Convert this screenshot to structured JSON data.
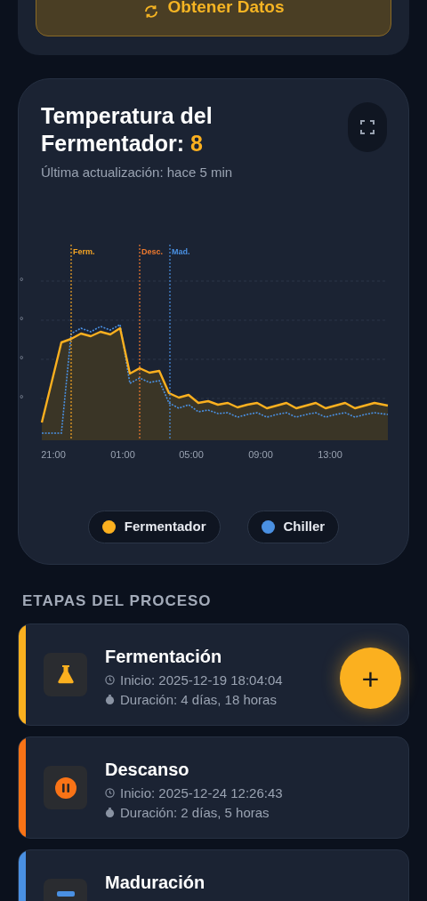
{
  "top_card": {
    "button": "Obtener Datos"
  },
  "chart_card": {
    "title": "Temperatura del Fermentador: ",
    "value": "8",
    "subtitle": "Última actualización: hace 5 min",
    "y_labels": [
      "°",
      "°",
      "°",
      "°"
    ],
    "x_labels": [
      "21:00",
      "01:00",
      "05:00",
      "09:00",
      "13:00"
    ],
    "markers": [
      {
        "label": "Ferm.",
        "color": "#f5a524"
      },
      {
        "label": "Desc.",
        "color": "#f07a2e"
      },
      {
        "label": "Mad.",
        "color": "#4a90e2"
      }
    ],
    "legend": [
      {
        "label": "Fermentador",
        "color": "#fbb01f"
      },
      {
        "label": "Chiller",
        "color": "#4a90e2"
      }
    ]
  },
  "section_title": "ETAPAS DEL PROCESO",
  "stages": [
    {
      "kind": "flask",
      "name": "Fermentación",
      "start": "Inicio: 2025-12-19 18:04:04",
      "duration": "Duración: 4 días, 18 horas",
      "color": "#fbb01f"
    },
    {
      "kind": "pause",
      "name": "Descanso",
      "start": "Inicio: 2025-12-24 12:26:43",
      "duration": "Duración: 2 días, 5 horas",
      "color": "#f97316"
    },
    {
      "kind": "snow",
      "name": "Maduración",
      "color": "#4a90e2"
    }
  ],
  "fab": "+"
}
